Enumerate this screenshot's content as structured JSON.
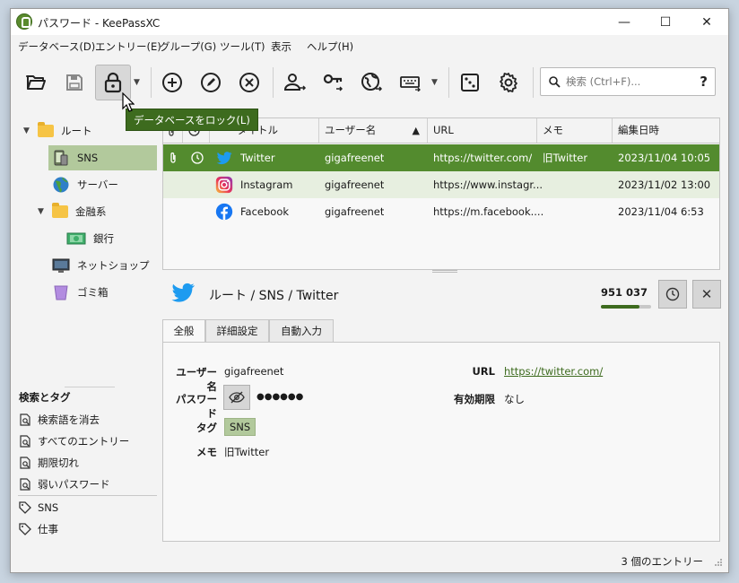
{
  "window": {
    "title": "パスワード - KeePassXC",
    "minimize": "—",
    "maximize": "☐",
    "close": "✕"
  },
  "menu": [
    "データベース(D)",
    "エントリー(E)",
    "グループ(G)",
    "ツール(T)",
    "表示",
    "ヘルプ(H)"
  ],
  "toolbar": {
    "search_placeholder": "検索 (Ctrl+F)...",
    "search_help": "?",
    "dropdown_arrow": "▼",
    "tooltip": "データベースをロック(L)",
    "active_button": "lock"
  },
  "sidebar": {
    "tree": [
      {
        "label": "ルート",
        "icon": "folder-icon",
        "expanded": true
      },
      {
        "label": "SNS",
        "icon": "phone-icon",
        "selected": true
      },
      {
        "label": "サーバー",
        "icon": "globe-icon"
      },
      {
        "label": "金融系",
        "icon": "folder-icon",
        "expanded": true
      },
      {
        "label": "銀行",
        "icon": "money-icon"
      },
      {
        "label": "ネットショップ",
        "icon": "monitor-icon"
      },
      {
        "label": "ゴミ箱",
        "icon": "trash-icon"
      }
    ],
    "search_tags_title": "検索とタグ",
    "searches": [
      "検索語を消去",
      "すべてのエントリー",
      "期限切れ",
      "弱いパスワード"
    ],
    "tags": [
      "SNS",
      "仕事"
    ]
  },
  "table": {
    "headers": {
      "title": "タイトル",
      "username": "ユーザー名",
      "sort_arrow": "▲",
      "url": "URL",
      "notes": "メモ",
      "modified": "編集日時"
    },
    "rows": [
      {
        "title": "Twitter",
        "icon": "twitter-icon",
        "username": "gigafreenet",
        "url": "https://twitter.com/",
        "notes": "旧Twitter",
        "modified": "2023/11/04 10:05",
        "selected": true,
        "attachment": true,
        "history": true
      },
      {
        "title": "Instagram",
        "icon": "instagram-icon",
        "username": "gigafreenet",
        "url": "https://www.instagr...",
        "notes": "",
        "modified": "2023/11/02 13:00"
      },
      {
        "title": "Facebook",
        "icon": "facebook-icon",
        "username": "gigafreenet",
        "url": "https://m.facebook....",
        "notes": "",
        "modified": "2023/11/04 6:53"
      }
    ]
  },
  "preview": {
    "breadcrumb": "ルート / SNS / Twitter",
    "totp": "951 037",
    "totp_progress": 0.76,
    "close": "✕",
    "tabs": [
      "全般",
      "詳細設定",
      "自動入力"
    ],
    "fields": {
      "username_label": "ユーザー名",
      "username": "gigafreenet",
      "password_label": "パスワード",
      "password": "●●●●●●",
      "url_label": "URL",
      "url": "https://twitter.com/",
      "expiry_label": "有効期限",
      "expiry": "なし",
      "tags_label": "タグ",
      "tag": "SNS",
      "notes_label": "メモ",
      "notes": "旧Twitter"
    }
  },
  "status": "3 個のエントリー",
  "colors": {
    "accent": "#538b2e",
    "selection_light": "#b2c99c",
    "tooltip": "#3d6b1e",
    "twitter": "#1d9bf0",
    "facebook": "#1877f2"
  }
}
